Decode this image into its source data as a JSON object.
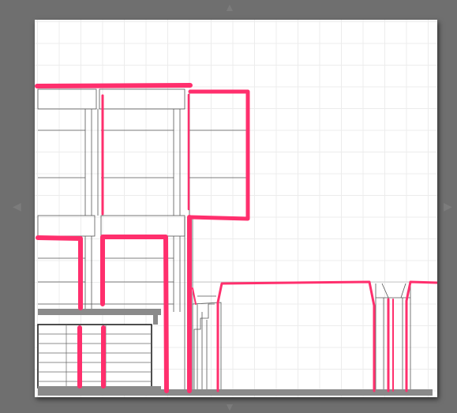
{
  "canvas": {
    "background_color": "#6f6f6f",
    "sheet_color": "#ffffff",
    "grid_color": "#ececec",
    "outline_color": "#444444",
    "ground_color": "#8a8a8a",
    "markup_color": "#ff2f6d"
  },
  "nav_icons": {
    "left": "chevron-left-icon",
    "right": "chevron-right-icon",
    "up": "chevron-up-icon",
    "down": "chevron-down-icon"
  },
  "drawing": {
    "kind": "building elevation sketch with highlighted markup strokes",
    "label_text": ""
  }
}
